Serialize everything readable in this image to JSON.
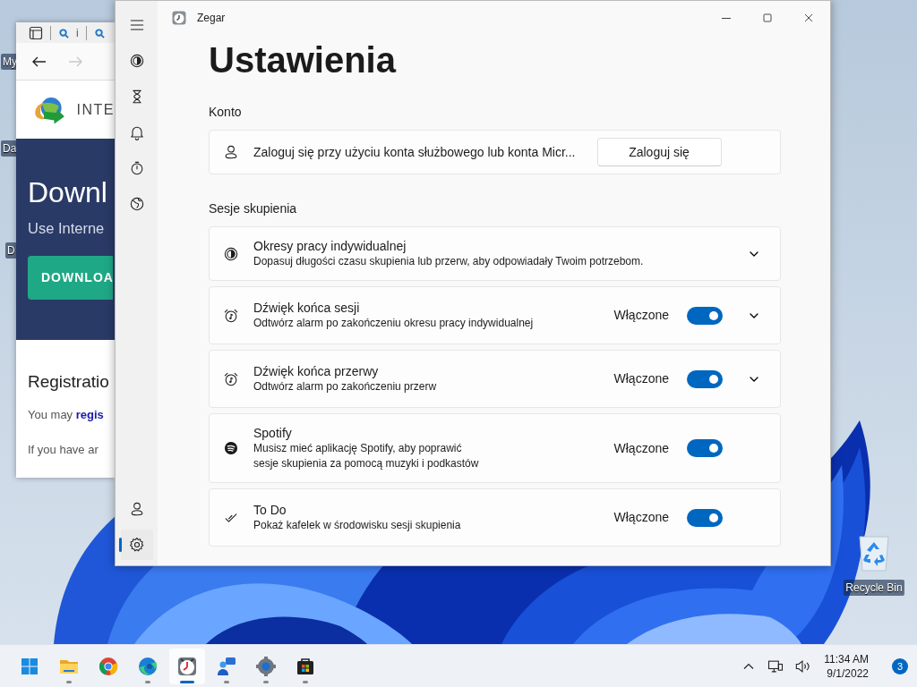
{
  "desktop": {
    "icons": [
      {
        "label": "My",
        "kind": "cut"
      },
      {
        "label": "Da",
        "kind": "cut"
      },
      {
        "label": "D",
        "kind": "cut"
      },
      {
        "label": "Recycle Bin",
        "kind": "recycle"
      }
    ]
  },
  "browser": {
    "toolbar_text": "i",
    "nav_buttons": [
      {
        "kind": "back",
        "disabled": false
      },
      {
        "kind": "forward",
        "disabled": true
      }
    ],
    "page": {
      "brand": "INTE",
      "hero_title": "Downl",
      "hero_subtitle": "Use Interne",
      "hero_button": "DOWNLOA",
      "section_title": "Registratio",
      "paragraphs": [
        {
          "text": "You may ",
          "link": "regis"
        },
        {
          "text": "If you have ar"
        }
      ]
    }
  },
  "clock_window": {
    "title": "Zegar",
    "sidebar": {
      "items": [
        {
          "kind": "focus",
          "selected": false
        },
        {
          "kind": "timer",
          "selected": false
        },
        {
          "kind": "alarm",
          "selected": false
        },
        {
          "kind": "stopwatch",
          "selected": false
        },
        {
          "kind": "world",
          "selected": false
        }
      ],
      "footer_items": [
        {
          "kind": "account",
          "selected": false
        },
        {
          "kind": "settings",
          "selected": true
        }
      ]
    },
    "heading": "Ustawienia",
    "sections": [
      {
        "title": "Konto",
        "cards": [
          {
            "kind": "account",
            "text": "Zaloguj się przy użyciu konta służbowego lub konta Micr...",
            "button": "Zaloguj się"
          }
        ]
      },
      {
        "title": "Sesje skupienia",
        "cards": [
          {
            "kind": "focus_periods",
            "title": "Okresy pracy indywidualnej",
            "description": "Dopasuj długości czasu skupienia lub przerw, aby odpowiadały Twoim potrzebom.",
            "expanded": false
          },
          {
            "kind": "session_sound",
            "title": "Dźwięk końca sesji",
            "description": "Odtwórz alarm po zakończeniu okresu pracy indywidualnej",
            "state_label": "Włączone",
            "on": true,
            "expanded": false
          },
          {
            "kind": "break_sound",
            "title": "Dźwięk końca przerwy",
            "description": "Odtwórz alarm po zakończeniu przerw",
            "state_label": "Włączone",
            "on": true,
            "expanded": false
          },
          {
            "kind": "spotify",
            "title": "Spotify",
            "description": "Musisz mieć aplikację Spotify, aby poprawić\nsesje skupienia za pomocą muzyki i podkastów",
            "state_label": "Włączone",
            "on": true
          },
          {
            "kind": "todo",
            "title": "To Do",
            "description": "Pokaż kafelek w środowisku sesji skupienia",
            "state_label": "Włączone",
            "on": true
          }
        ]
      }
    ]
  },
  "taskbar": {
    "apps": [
      {
        "kind": "start",
        "running": false,
        "active": false
      },
      {
        "kind": "explorer",
        "running": true,
        "active": false
      },
      {
        "kind": "chrome",
        "running": false,
        "active": false
      },
      {
        "kind": "edge",
        "running": true,
        "active": false
      },
      {
        "kind": "clock",
        "running": true,
        "active": true
      },
      {
        "kind": "chat",
        "running": true,
        "active": false
      },
      {
        "kind": "settings",
        "running": true,
        "active": false
      },
      {
        "kind": "store",
        "running": true,
        "active": false
      }
    ],
    "time": "11:34 AM",
    "date": "9/1/2022",
    "notifications": "3"
  }
}
